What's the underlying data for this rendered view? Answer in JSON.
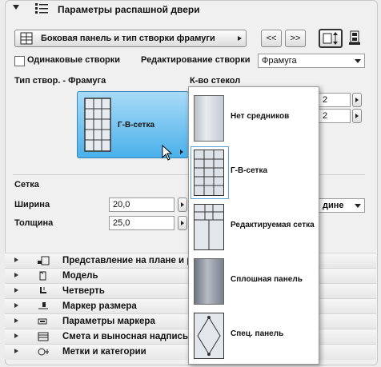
{
  "header": {
    "title": "Параметры распашной двери"
  },
  "toolbar": {
    "panel_dropdown_label": "Боковая панель и тип створки фрамуги",
    "prev_label": "<<",
    "next_label": ">>"
  },
  "options": {
    "same_leaves_label": "Одинаковые створки",
    "edit_leaf_label": "Редактирование створки",
    "edit_leaf_value": "Фрамуга"
  },
  "type_section": {
    "title": "Тип створ. - Фрамуга",
    "selected_type": "Г-В-сетка",
    "glass_count_label": "К-во стекол",
    "glass_count_1": "2",
    "glass_count_2": "2"
  },
  "grid_section": {
    "title": "Сетка",
    "width_label": "Ширина",
    "width_value": "20,0",
    "thickness_label": "Толщина",
    "thickness_value": "25,0",
    "right_dropdown_value": "дине"
  },
  "popup": {
    "items": [
      {
        "label": "Нет средников"
      },
      {
        "label": "Г-В-сетка"
      },
      {
        "label": "Редактируемая сетка"
      },
      {
        "label": "Сплошная панель"
      },
      {
        "label": "Спец. панель"
      }
    ]
  },
  "sections": [
    {
      "label": "Представление на плане и р",
      "icon": "floorplan-icon"
    },
    {
      "label": "Модель",
      "icon": "model-icon"
    },
    {
      "label": "Четверть",
      "icon": "rebate-icon"
    },
    {
      "label": "Маркер размера",
      "icon": "dimension-marker-icon"
    },
    {
      "label": "Параметры маркера",
      "icon": "marker-settings-icon"
    },
    {
      "label": "Смета и выносная надпись",
      "icon": "schedule-icon"
    },
    {
      "label": "Метки и категории",
      "icon": "tags-icon"
    }
  ]
}
